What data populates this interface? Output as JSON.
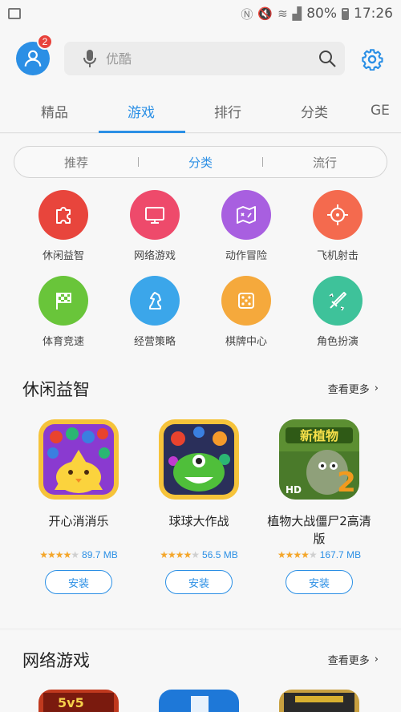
{
  "status": {
    "battery": "80%",
    "time": "17:26"
  },
  "header": {
    "badge_count": "2",
    "search_placeholder": "优酷"
  },
  "tabs": [
    {
      "label": "精品"
    },
    {
      "label": "游戏"
    },
    {
      "label": "排行"
    },
    {
      "label": "分类"
    },
    {
      "label": "GE"
    }
  ],
  "active_tab": "游戏",
  "segments": [
    {
      "label": "推荐"
    },
    {
      "label": "分类"
    },
    {
      "label": "流行"
    }
  ],
  "categories": [
    {
      "label": "休闲益智",
      "icon": "puzzle-icon",
      "color": "#e8453c"
    },
    {
      "label": "网络游戏",
      "icon": "monitor-icon",
      "color": "#ee4a6b"
    },
    {
      "label": "动作冒险",
      "icon": "map-icon",
      "color": "#a85fe0"
    },
    {
      "label": "飞机射击",
      "icon": "crosshair-icon",
      "color": "#f46a4e"
    },
    {
      "label": "体育竞速",
      "icon": "flag-icon",
      "color": "#69c53a"
    },
    {
      "label": "经营策略",
      "icon": "chess-knight-icon",
      "color": "#3ba6ea"
    },
    {
      "label": "棋牌中心",
      "icon": "dice-icon",
      "color": "#f5a93c"
    },
    {
      "label": "角色扮演",
      "icon": "sword-icon",
      "color": "#3ec29a"
    }
  ],
  "sections": [
    {
      "title": "休闲益智",
      "more": "查看更多",
      "apps": [
        {
          "name": "开心消消乐",
          "size": "89.7 MB",
          "rating": 4,
          "install": "安装"
        },
        {
          "name": "球球大作战",
          "size": "56.5 MB",
          "rating": 4,
          "install": "安装"
        },
        {
          "name": "植物大战僵尸2高清版",
          "size": "167.7 MB",
          "rating": 4,
          "install": "安装"
        }
      ]
    },
    {
      "title": "网络游戏",
      "more": "查看更多"
    }
  ]
}
